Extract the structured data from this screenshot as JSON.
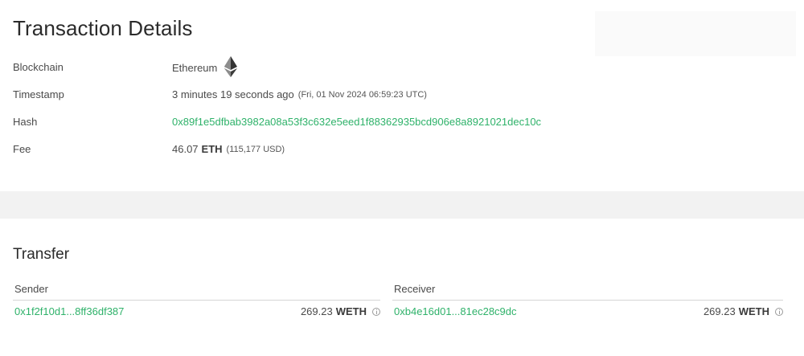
{
  "details": {
    "title": "Transaction Details",
    "rows": [
      {
        "label": "Blockchain",
        "value": "Ethereum",
        "icon": "ethereum-icon"
      },
      {
        "label": "Timestamp",
        "value": "3 minutes 19 seconds ago",
        "detail": "(Fri, 01 Nov 2024 06:59:23 UTC)"
      },
      {
        "label": "Hash",
        "value": "0x89f1e5dfbab3982a08a53f3c632e5eed1f88362935bcd906e8a8921021dec10c"
      },
      {
        "label": "Fee",
        "amount": "46.07",
        "unit": "ETH",
        "detail": "(115,177 USD)"
      }
    ]
  },
  "transfer": {
    "title": "Transfer",
    "sender": {
      "heading": "Sender",
      "address": "0x1f2f10d1...8ff36df387",
      "amount": "269.23",
      "unit": "WETH",
      "icon": "info-icon"
    },
    "receiver": {
      "heading": "Receiver",
      "address": "0xb4e16d01...81ec28c9dc",
      "amount": "269.23",
      "unit": "WETH",
      "icon": "info-icon"
    }
  },
  "colors": {
    "link_green": "#2fb26a",
    "band_gray": "#f2f2f2"
  }
}
